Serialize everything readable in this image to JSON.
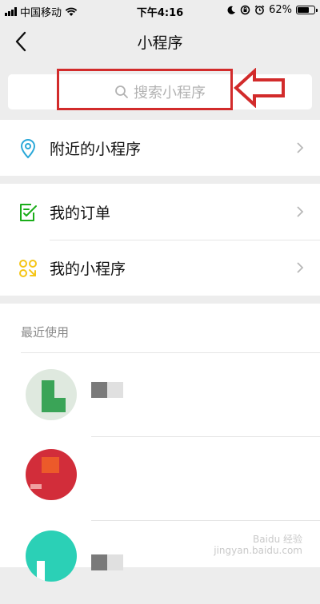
{
  "status_bar": {
    "carrier": "中国移动",
    "time": "下午4:16",
    "battery": "62%",
    "battery_level": 0.62
  },
  "nav": {
    "title": "小程序"
  },
  "search": {
    "placeholder": "搜索小程序"
  },
  "menu_groups": [
    {
      "items": [
        {
          "label": "附近的小程序",
          "icon": "location-pin-icon"
        }
      ]
    },
    {
      "items": [
        {
          "label": "我的订单",
          "icon": "order-check-icon"
        },
        {
          "label": "我的小程序",
          "icon": "mini-program-icon"
        }
      ]
    }
  ],
  "recent": {
    "section_label": "最近使用"
  },
  "colors": {
    "accent_green": "#1aad19",
    "location_blue": "#2ba8d8",
    "miniprogram_yellow": "#f5c518",
    "annotation_red": "#d22b2b"
  },
  "watermark": {
    "line1": "Baidu 经验",
    "line2": "jingyan.baidu.com"
  }
}
